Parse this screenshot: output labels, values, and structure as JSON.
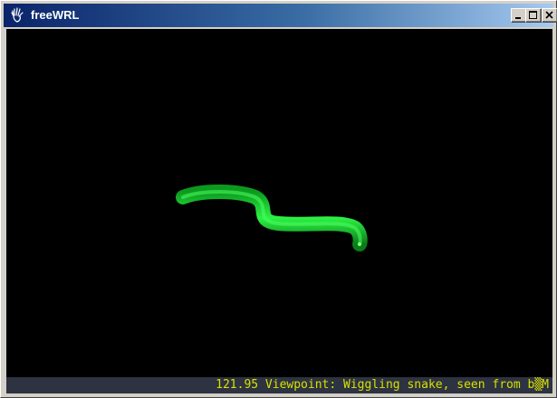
{
  "window": {
    "title": "freeWRL",
    "app_icon": "freewrl-hand-icon"
  },
  "titlebar_buttons": [
    {
      "name": "minimize",
      "icon": "minimize-icon"
    },
    {
      "name": "maximize",
      "icon": "maximize-icon"
    },
    {
      "name": "close",
      "icon": "close-icon"
    }
  ],
  "scene": {
    "background_color": "#000000",
    "object": "snake",
    "object_color": "#22e83a"
  },
  "status": {
    "text": "121.95 Viewpoint: Wiggling snake, seen from b▒M",
    "color": "#d9e000"
  }
}
